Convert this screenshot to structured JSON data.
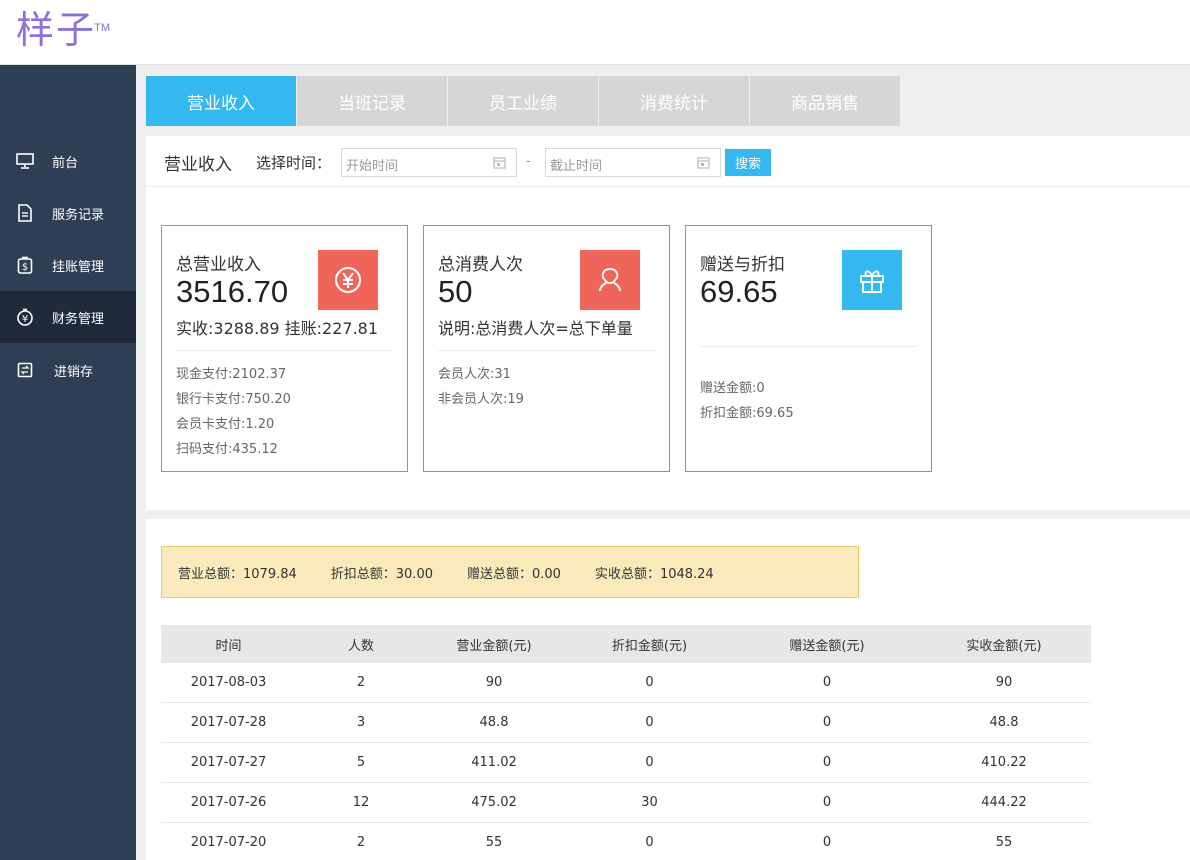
{
  "brand": {
    "logo_text": "样子",
    "logo_mark": "TM"
  },
  "sidebar": {
    "items": [
      {
        "label": "前台",
        "icon": "monitor-icon"
      },
      {
        "label": "服务记录",
        "icon": "document-icon"
      },
      {
        "label": "挂账管理",
        "icon": "money-bag-icon"
      },
      {
        "label": "财务管理",
        "icon": "finance-icon"
      },
      {
        "label": "进销存",
        "icon": "inventory-icon"
      }
    ],
    "active_index": 3
  },
  "tabs": [
    "营业收入",
    "当班记录",
    "员工业绩",
    "消费统计",
    "商品销售"
  ],
  "active_tab": 0,
  "filter": {
    "title": "营业收入",
    "time_label": "选择时间：",
    "start_placeholder": "开始时间",
    "end_placeholder": "截止时间",
    "dash": "-",
    "search_label": "搜索"
  },
  "cards": [
    {
      "label": "总营业收入",
      "value": "3516.70",
      "sub": "实收:3288.89 挂账:227.81",
      "icon": "yen-icon",
      "color": "#f0655a",
      "lines": [
        "现金支付:2102.37",
        "银行卡支付:750.20",
        "会员卡支付:1.20",
        "扫码支付:435.12"
      ]
    },
    {
      "label": "总消费人次",
      "value": "50",
      "sub": "说明:总消费人次=总下单量",
      "icon": "user-icon",
      "color": "#f0655a",
      "lines": [
        "会员人次:31",
        "非会员人次:19"
      ]
    },
    {
      "label": "赠送与折扣",
      "value": "69.65",
      "sub": "",
      "icon": "gift-icon",
      "color": "#33b8f0",
      "lines": [
        "赠送金额:0",
        "折扣金额:69.65"
      ]
    }
  ],
  "summary": {
    "revenue": "营业总额：1079.84",
    "discount": "折扣总额：30.00",
    "gift": "赠送总额：0.00",
    "actual": "实收总额：1048.24"
  },
  "table": {
    "headers": [
      "时间",
      "人数",
      "营业金额(元)",
      "折扣金额(元)",
      "赠送金额(元)",
      "实收金额(元)"
    ],
    "rows": [
      [
        "2017-08-03",
        "2",
        "90",
        "0",
        "0",
        "90"
      ],
      [
        "2017-07-28",
        "3",
        "48.8",
        "0",
        "0",
        "48.8"
      ],
      [
        "2017-07-27",
        "5",
        "411.02",
        "0",
        "0",
        "410.22"
      ],
      [
        "2017-07-26",
        "12",
        "475.02",
        "30",
        "0",
        "444.22"
      ],
      [
        "2017-07-20",
        "2",
        "55",
        "0",
        "0",
        "55"
      ]
    ]
  }
}
